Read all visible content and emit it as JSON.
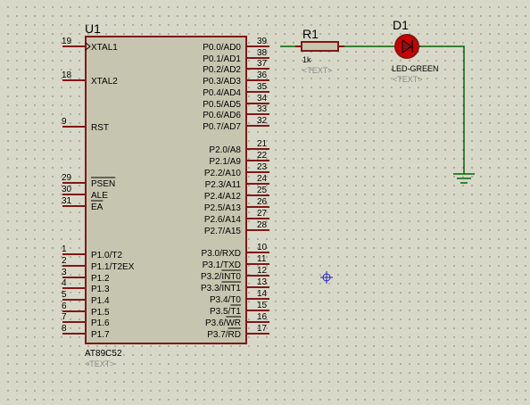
{
  "mcu": {
    "ref": "U1",
    "part": "AT89C52",
    "text_placeholder": "<TEXT>",
    "left_pins": [
      {
        "num": "19",
        "name": "XTAL1",
        "clock": true
      },
      {
        "num": "18",
        "name": "XTAL2"
      },
      {
        "num": "9",
        "name": "RST"
      },
      {
        "num": "29",
        "name": "PSEN",
        "overbar": true
      },
      {
        "num": "30",
        "name": "ALE"
      },
      {
        "num": "31",
        "name": "EA",
        "overbar": true
      },
      {
        "num": "1",
        "name": "P1.0/T2"
      },
      {
        "num": "2",
        "name": "P1.1/T2EX"
      },
      {
        "num": "3",
        "name": "P1.2"
      },
      {
        "num": "4",
        "name": "P1.3"
      },
      {
        "num": "5",
        "name": "P1.4"
      },
      {
        "num": "6",
        "name": "P1.5"
      },
      {
        "num": "7",
        "name": "P1.6"
      },
      {
        "num": "8",
        "name": "P1.7"
      }
    ],
    "right_pins": [
      {
        "num": "39",
        "name": "P0.0/AD0"
      },
      {
        "num": "38",
        "name": "P0.1/AD1"
      },
      {
        "num": "37",
        "name": "P0.2/AD2"
      },
      {
        "num": "36",
        "name": "P0.3/AD3"
      },
      {
        "num": "35",
        "name": "P0.4/AD4"
      },
      {
        "num": "34",
        "name": "P0.5/AD5"
      },
      {
        "num": "33",
        "name": "P0.6/AD6"
      },
      {
        "num": "32",
        "name": "P0.7/AD7"
      },
      {
        "num": "21",
        "name": "P2.0/A8"
      },
      {
        "num": "22",
        "name": "P2.1/A9"
      },
      {
        "num": "23",
        "name": "P2.2/A10"
      },
      {
        "num": "24",
        "name": "P2.3/A11"
      },
      {
        "num": "25",
        "name": "P2.4/A12"
      },
      {
        "num": "26",
        "name": "P2.5/A13"
      },
      {
        "num": "27",
        "name": "P2.6/A14"
      },
      {
        "num": "28",
        "name": "P2.7/A15"
      },
      {
        "num": "10",
        "name": "P3.0/RXD"
      },
      {
        "num": "11",
        "name": "P3.1/TXD"
      },
      {
        "num": "12",
        "name": "P3.2/INT0",
        "bar": "INT0"
      },
      {
        "num": "13",
        "name": "P3.3/INT1",
        "bar": "INT1"
      },
      {
        "num": "14",
        "name": "P3.4/T0"
      },
      {
        "num": "15",
        "name": "P3.5/T1",
        "bar": "T1"
      },
      {
        "num": "16",
        "name": "P3.6/WR",
        "bar": "WR"
      },
      {
        "num": "17",
        "name": "P3.7/RD",
        "bar": "RD"
      }
    ]
  },
  "resistor": {
    "ref": "R1",
    "value": "1k",
    "text_placeholder": "<TEXT>"
  },
  "led": {
    "ref": "D1",
    "part": "LED-GREEN",
    "text_placeholder": "<TEXT>"
  },
  "colors": {
    "body_fill": "#c6c6b0",
    "outline": "#7f1818",
    "wire": "#006400",
    "text": "#000000",
    "placeholder": "#8a8a8a",
    "marker": "#2222cc",
    "led_fill": "#cc0000"
  }
}
